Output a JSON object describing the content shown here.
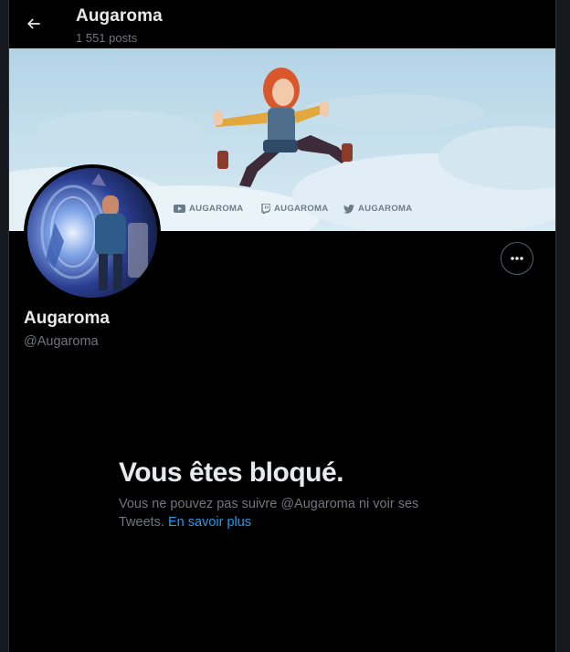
{
  "header": {
    "title": "Augaroma",
    "post_count": "1 551 posts"
  },
  "banner": {
    "social": [
      {
        "icon": "youtube-icon",
        "label": "AUGAROMA"
      },
      {
        "icon": "twitch-icon",
        "label": "AUGAROMA"
      },
      {
        "icon": "twitter-bird-icon",
        "label": "AUGAROMA"
      }
    ]
  },
  "profile": {
    "name": "Augaroma",
    "handle": "@Augaroma"
  },
  "blocked": {
    "title": "Vous êtes bloqué.",
    "message": "Vous ne pouvez pas suivre @Augaroma ni voir ses Tweets.",
    "link_label": "En savoir plus"
  },
  "colors": {
    "background": "#000000",
    "text_primary": "#e7e9ea",
    "text_secondary": "#71767b",
    "link": "#1d9bf0",
    "banner_sky": "#c3dde9"
  }
}
